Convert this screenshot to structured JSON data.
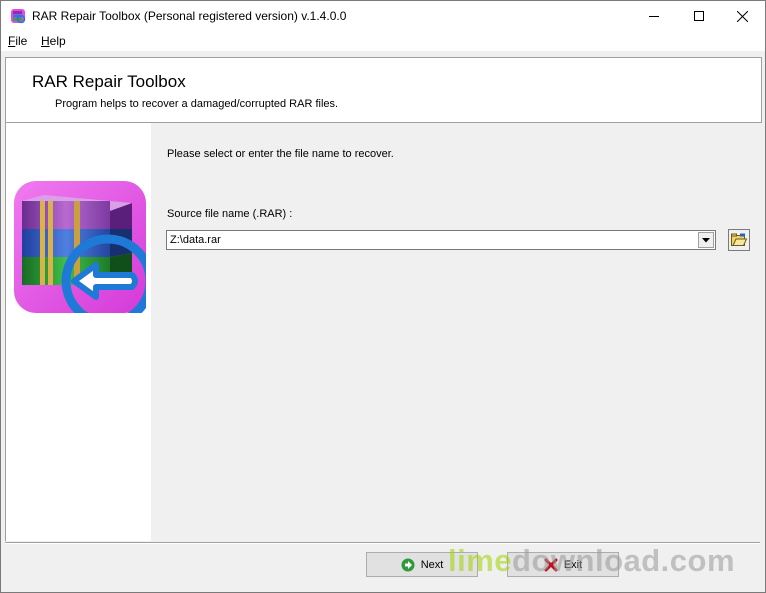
{
  "window": {
    "title": "RAR Repair Toolbox (Personal registered version) v.1.4.0.0",
    "icon": "rar-repair-app-icon",
    "controls": [
      "minimize-icon",
      "maximize-icon",
      "close-icon"
    ]
  },
  "menu": {
    "file_underline": "F",
    "file_rest": "ile",
    "help_underline": "H",
    "help_rest": "elp"
  },
  "header": {
    "title": "RAR Repair Toolbox",
    "subtitle": "Program helps to recover a damaged/corrupted RAR files."
  },
  "main": {
    "instruction": "Please select or enter the file name to recover.",
    "source_label": "Source file name (.RAR) :",
    "source_value": "Z:\\data.rar",
    "browse_icon": "open-folder-icon"
  },
  "buttons": {
    "next_label": "Next",
    "exit_label": "Exit",
    "next_icon": "green-arrow-right-icon",
    "exit_icon": "red-x-icon"
  },
  "watermark": {
    "part1": "lime",
    "part2": "download.com"
  },
  "colors": {
    "accent_blue": "#1e7ad6",
    "next_green": "#2e9a3a",
    "exit_red": "#c0121d",
    "logo_pink": "#e44be4"
  }
}
